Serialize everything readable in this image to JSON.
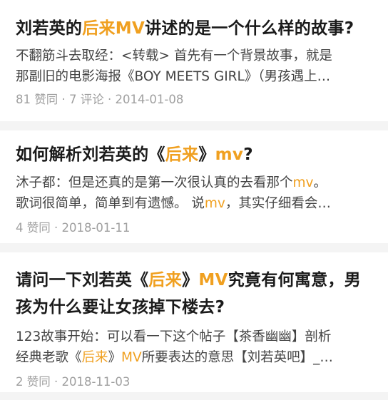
{
  "accent_color": "#f0a020",
  "results": [
    {
      "title": [
        "刘若英的",
        "后来MV",
        "讲述的是一个什么样的故事?"
      ],
      "title_highlight": [
        false,
        true,
        false
      ],
      "excerpt_line1": [
        "不翻筋斗去取经：<转载> 首先有一个背景故事，就是"
      ],
      "excerpt_line1_highlight": [
        false
      ],
      "excerpt_line2": [
        "那副旧的电影海报《BOY MEETS GIRL》（男孩遇上…"
      ],
      "excerpt_line2_highlight": [
        false
      ],
      "meta": "81 赞同 · 7 评论 · 2014-01-08"
    },
    {
      "title": [
        "如何解析刘若英的《",
        "后来",
        "》",
        "mv",
        "?"
      ],
      "title_highlight": [
        false,
        true,
        false,
        true,
        false
      ],
      "excerpt_line1": [
        "沐子都：但是还真的是第一次很认真的去看那个",
        "mv",
        "。"
      ],
      "excerpt_line1_highlight": [
        false,
        true,
        false
      ],
      "excerpt_line2": [
        "歌词很简单，简单到有遗憾。 说",
        "mv",
        "，其实仔细看会…"
      ],
      "excerpt_line2_highlight": [
        false,
        true,
        false
      ],
      "meta": "4 赞同 · 2018-01-11"
    },
    {
      "title_line1": [
        "请问一下刘若英《",
        "后来",
        "》",
        "MV",
        "究竟有何寓意，男"
      ],
      "title_line1_highlight": [
        false,
        true,
        false,
        true,
        false
      ],
      "title_line2": [
        "孩为什么要让女孩掉下楼去?"
      ],
      "title_line2_highlight": [
        false
      ],
      "excerpt_line1": [
        "123故事开始：可以看一下这个帖子【茶香幽幽】剖析"
      ],
      "excerpt_line1_highlight": [
        false
      ],
      "excerpt_line2": [
        "经典老歌《",
        "后来",
        "》",
        "MV",
        "所要表达的意思【刘若英吧】_…"
      ],
      "excerpt_line2_highlight": [
        false,
        true,
        false,
        true,
        false
      ],
      "meta": "2 赞同 · 2018-11-03"
    }
  ]
}
